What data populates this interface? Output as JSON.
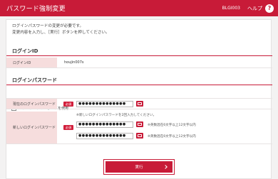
{
  "header": {
    "title": "パスワード強制変更",
    "screen_id": "BLGI003",
    "help_label": "ヘルプ",
    "help_icon": "?"
  },
  "intro": {
    "line1": "ログインパスワードの変更が必要です。",
    "line2": "変更内容を入力し、［実行］ボタンを押してください。"
  },
  "login_id_section": {
    "title": "ログインID",
    "label": "ログインID",
    "value": "houjin007s"
  },
  "password_section": {
    "title": "ログインパスワード",
    "software_keyboard_label": "ソフトウェアキーボードを使用",
    "software_keyboard_checked": false,
    "current": {
      "label": "現在のログインパスワード",
      "required": "必須",
      "value": "●●●●●●●●●●●●●●"
    },
    "new": {
      "label": "新しいログインパスワード",
      "required": "必須",
      "note_top": "※新しいログインパスワードを2回入力してください。",
      "value1": "●●●●●●●●●●●●●●",
      "note1": "※英数混在6文字以上12文字以内",
      "value2": "●●●●●●●●●●●●●●",
      "note2": "※英数混在6文字以上12文字以内"
    }
  },
  "execute_label": "実行",
  "colors": {
    "brand": "#c81b38",
    "label_bg": "#f6dddd"
  }
}
